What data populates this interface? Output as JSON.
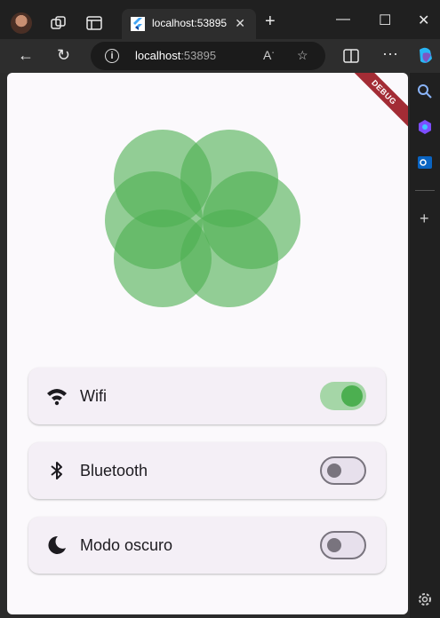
{
  "browser": {
    "tab": {
      "title": "localhost:53895"
    },
    "url": {
      "host": "localhost",
      "port": ":53895"
    }
  },
  "app": {
    "debug_banner": "DEBUG",
    "flower_color": "#4caf50",
    "settings": [
      {
        "label": "Wifi",
        "icon": "wifi-icon",
        "enabled": true
      },
      {
        "label": "Bluetooth",
        "icon": "bluetooth-icon",
        "enabled": false
      },
      {
        "label": "Modo oscuro",
        "icon": "moon-icon",
        "enabled": false
      }
    ]
  }
}
